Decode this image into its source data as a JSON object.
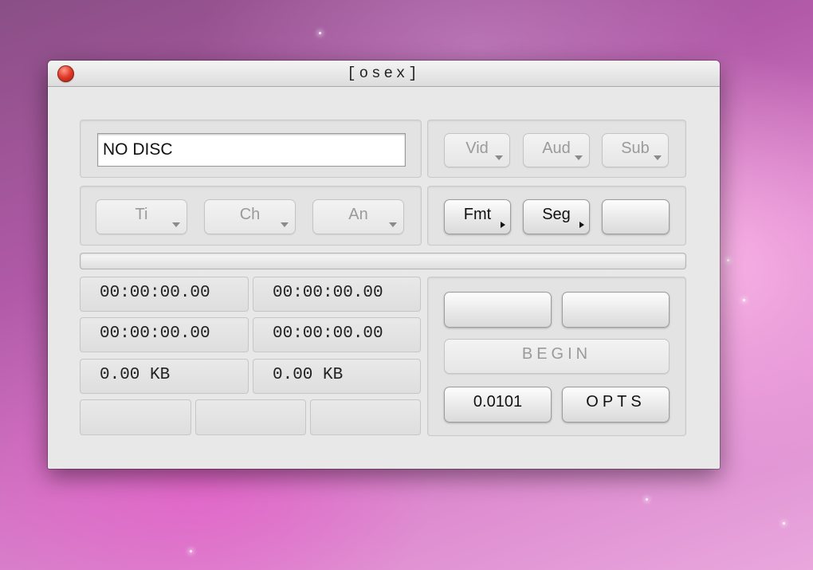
{
  "window": {
    "title": "[osex]"
  },
  "disc": {
    "status": "NO DISC"
  },
  "streams": {
    "video_label": "Vid",
    "audio_label": "Aud",
    "subtitle_label": "Sub"
  },
  "selectors": {
    "title_label": "Ti",
    "chapter_label": "Ch",
    "angle_label": "An"
  },
  "output": {
    "format_label": "Fmt",
    "segment_label": "Seg",
    "extra_label": ""
  },
  "progress": {
    "fraction": 0
  },
  "timecodes": {
    "row1_left": "00:00:00.00",
    "row1_right": "00:00:00.00",
    "row2_left": "00:00:00.00",
    "row2_right": "00:00:00.00"
  },
  "sizes": {
    "left": "0.00 KB",
    "right": "0.00 KB"
  },
  "controls": {
    "begin_label": "BEGIN",
    "version": "0.0101",
    "opts_label": "OPTS",
    "blank1_label": "",
    "blank2_label": ""
  },
  "icons": {
    "close": "close-icon",
    "popup": "chevron-down-icon",
    "submenu": "chevron-right-icon"
  }
}
